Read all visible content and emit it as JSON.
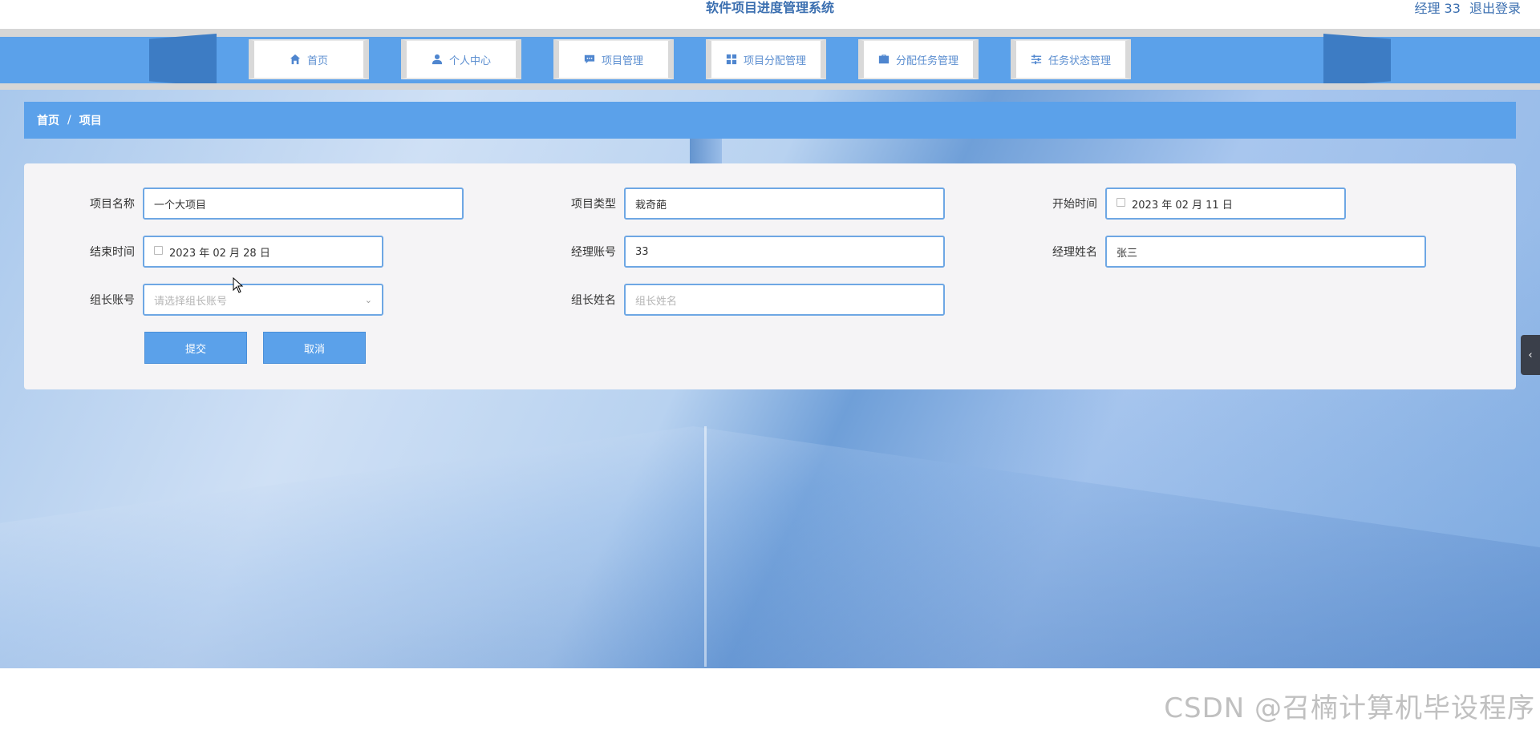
{
  "header": {
    "site_title": "软件项目进度管理系统",
    "user_label": "经理 33",
    "logout_label": "退出登录"
  },
  "nav": {
    "items": [
      {
        "label": "首页",
        "icon": "home-icon"
      },
      {
        "label": "个人中心",
        "icon": "user-icon"
      },
      {
        "label": "项目管理",
        "icon": "chat-icon"
      },
      {
        "label": "项目分配管理",
        "icon": "grid-icon"
      },
      {
        "label": "分配任务管理",
        "icon": "briefcase-icon"
      },
      {
        "label": "任务状态管理",
        "icon": "sliders-icon"
      }
    ]
  },
  "breadcrumb": {
    "home": "首页",
    "separator": "/",
    "current": "项目"
  },
  "form": {
    "project_name": {
      "label": "项目名称",
      "value": "一个大项目"
    },
    "project_type": {
      "label": "项目类型",
      "value": "栽奇葩"
    },
    "start_time": {
      "label": "开始时间",
      "value": "2023 年 02 月 11 日"
    },
    "end_time": {
      "label": "结束时间",
      "value": "2023 年 02 月 28 日"
    },
    "manager_account": {
      "label": "经理账号",
      "value": "33"
    },
    "manager_name": {
      "label": "经理姓名",
      "value": "张三"
    },
    "leader_account": {
      "label": "组长账号",
      "placeholder": "请选择组长账号"
    },
    "leader_name": {
      "label": "组长姓名",
      "placeholder": "组长姓名"
    },
    "submit_label": "提交",
    "cancel_label": "取消"
  },
  "side_tab": {
    "glyph": "‹"
  },
  "watermark": "CSDN @召楠计算机毕设程序",
  "colors": {
    "primary": "#5ba1ea",
    "nav_dark": "#3d7cc4",
    "title_text": "#3b6fb0",
    "input_border": "#6ea7e4"
  }
}
